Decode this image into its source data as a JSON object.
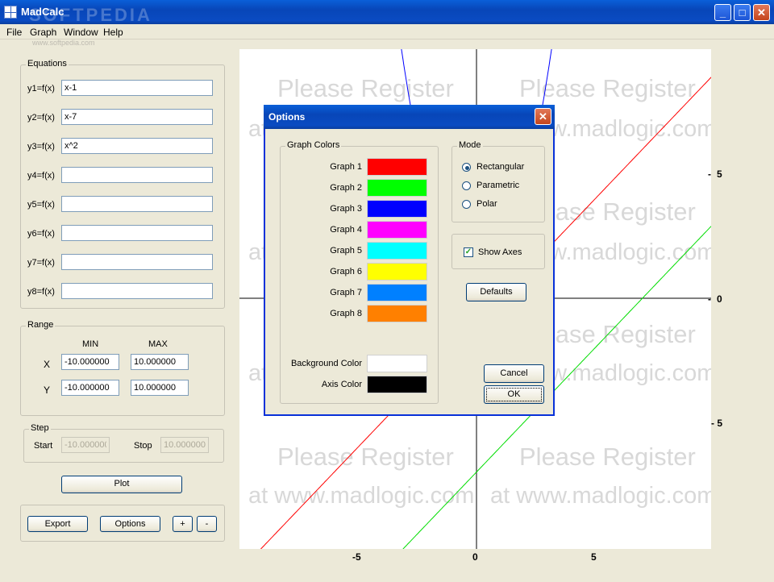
{
  "window": {
    "title": "MadCalc",
    "watermark": "SOFTPEDIA",
    "watermark_url": "www.softpedia.com"
  },
  "menu": [
    "File",
    "Graph",
    "Window",
    "Help"
  ],
  "equations": {
    "legend": "Equations",
    "rows": [
      {
        "label": "y1=f(x)",
        "value": "x-1"
      },
      {
        "label": "y2=f(x)",
        "value": "x-7"
      },
      {
        "label": "y3=f(x)",
        "value": "x^2"
      },
      {
        "label": "y4=f(x)",
        "value": ""
      },
      {
        "label": "y5=f(x)",
        "value": ""
      },
      {
        "label": "y6=f(x)",
        "value": ""
      },
      {
        "label": "y7=f(x)",
        "value": ""
      },
      {
        "label": "y8=f(x)",
        "value": ""
      }
    ]
  },
  "range": {
    "legend": "Range",
    "min_header": "MIN",
    "max_header": "MAX",
    "x_label": "X",
    "x_min": "-10.000000",
    "x_max": "10.000000",
    "y_label": "Y",
    "y_min": "-10.000000",
    "y_max": "10.000000"
  },
  "step": {
    "legend": "Step",
    "start_label": "Start",
    "start_value": "-10.000000",
    "stop_label": "Stop",
    "stop_value": "10.000000"
  },
  "buttons": {
    "plot": "Plot",
    "export": "Export",
    "options": "Options",
    "zoom_in": "+",
    "zoom_out": "-"
  },
  "plot": {
    "watermark_line1": "Please Register",
    "watermark_line2": "at www.madlogic.com",
    "x_ticks": [
      "-5",
      "0",
      "5"
    ],
    "y_ticks": [
      "5",
      "0",
      "- 5"
    ],
    "xlim": [
      -10,
      10
    ],
    "ylim": [
      -10,
      10
    ],
    "curves": [
      {
        "expr": "x-1",
        "color": "#ff0000"
      },
      {
        "expr": "x-7",
        "color": "#00dd00"
      },
      {
        "expr": "x^2",
        "color": "#0000ff"
      }
    ]
  },
  "dialog": {
    "title": "Options",
    "graph_colors_legend": "Graph Colors",
    "graphs": [
      {
        "label": "Graph 1",
        "color": "#ff0000"
      },
      {
        "label": "Graph 2",
        "color": "#00ff00"
      },
      {
        "label": "Graph 3",
        "color": "#0000ff"
      },
      {
        "label": "Graph 4",
        "color": "#ff00ff"
      },
      {
        "label": "Graph 5",
        "color": "#00ffff"
      },
      {
        "label": "Graph 6",
        "color": "#ffff00"
      },
      {
        "label": "Graph 7",
        "color": "#0080ff"
      },
      {
        "label": "Graph 8",
        "color": "#ff8000"
      }
    ],
    "background_color_label": "Background Color",
    "background_color": "#ffffff",
    "axis_color_label": "Axis Color",
    "axis_color": "#000000",
    "mode_legend": "Mode",
    "modes": [
      {
        "label": "Rectangular",
        "selected": true
      },
      {
        "label": "Parametric",
        "selected": false
      },
      {
        "label": "Polar",
        "selected": false
      }
    ],
    "show_axes_label": "Show Axes",
    "show_axes": true,
    "defaults_label": "Defaults",
    "cancel_label": "Cancel",
    "ok_label": "OK"
  }
}
